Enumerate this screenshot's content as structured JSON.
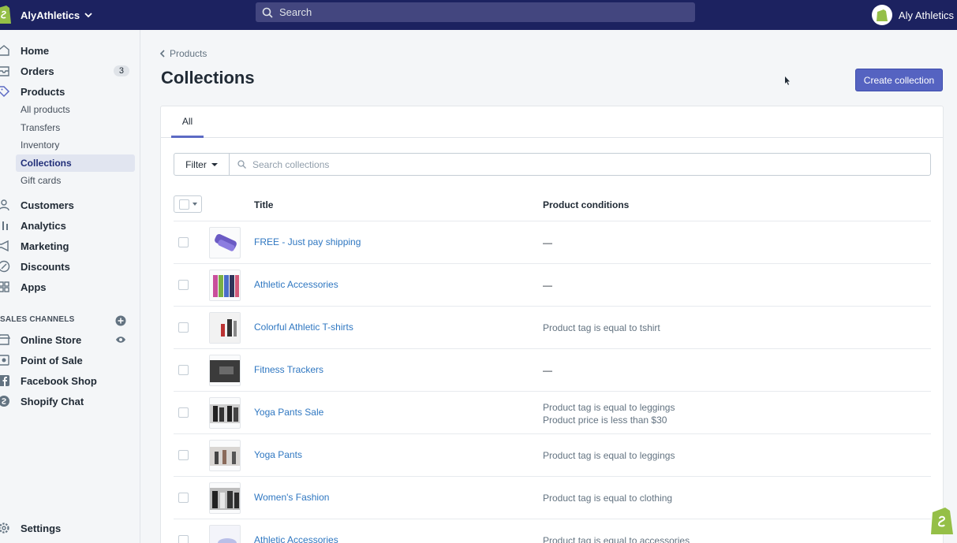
{
  "topbar": {
    "store_name": "AlyAthletics",
    "search_placeholder": "Search",
    "user_name": "Aly Athletics"
  },
  "sidebar": {
    "items": [
      {
        "label": "Home",
        "icon": "home-icon"
      },
      {
        "label": "Orders",
        "icon": "orders-icon",
        "badge": "3"
      },
      {
        "label": "Products",
        "icon": "tag-icon"
      },
      {
        "label": "Customers",
        "icon": "person-icon"
      },
      {
        "label": "Analytics",
        "icon": "bar-chart-icon"
      },
      {
        "label": "Marketing",
        "icon": "megaphone-icon"
      },
      {
        "label": "Discounts",
        "icon": "discount-icon"
      },
      {
        "label": "Apps",
        "icon": "apps-icon"
      }
    ],
    "product_sub": [
      "All products",
      "Transfers",
      "Inventory",
      "Collections",
      "Gift cards"
    ],
    "sales_channels_label": "SALES CHANNELS",
    "channels": [
      {
        "label": "Online Store",
        "icon": "store-icon"
      },
      {
        "label": "Point of Sale",
        "icon": "pos-icon"
      },
      {
        "label": "Facebook Shop",
        "icon": "facebook-icon"
      },
      {
        "label": "Shopify Chat",
        "icon": "shopify-chat-icon"
      }
    ],
    "settings_label": "Settings"
  },
  "main": {
    "breadcrumb": "Products",
    "title": "Collections",
    "create_button": "Create collection",
    "tab_all": "All",
    "filter_label": "Filter",
    "search_placeholder": "Search collections",
    "columns": {
      "title": "Title",
      "conditions": "Product conditions"
    },
    "rows": [
      {
        "title": "FREE - Just pay shipping",
        "cond1": "—",
        "cond2": ""
      },
      {
        "title": "Athletic Accessories",
        "cond1": "—",
        "cond2": ""
      },
      {
        "title": "Colorful Athletic T-shirts",
        "cond1": "Product tag is equal to tshirt",
        "cond2": ""
      },
      {
        "title": "Fitness Trackers",
        "cond1": "—",
        "cond2": ""
      },
      {
        "title": "Yoga Pants Sale",
        "cond1": "Product tag is equal to leggings",
        "cond2": "Product price is less than $30"
      },
      {
        "title": "Yoga Pants",
        "cond1": "Product tag is equal to leggings",
        "cond2": ""
      },
      {
        "title": "Women's Fashion",
        "cond1": "Product tag is equal to clothing",
        "cond2": ""
      },
      {
        "title": "Athletic Accessories",
        "cond1": "Product tag is equal to accessories",
        "cond2": ""
      }
    ]
  },
  "colors": {
    "topbar": "#1c2260",
    "accent": "#5563c1",
    "link": "#2f77c1",
    "shopify_green": "#95bf47"
  }
}
